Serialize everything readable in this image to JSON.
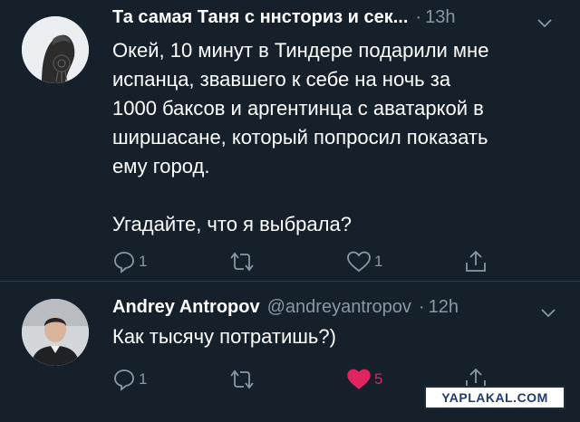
{
  "tweets": [
    {
      "author_name": "Та самая Таня с ннсториз и сек...",
      "separator": "·",
      "time": "13h",
      "text_lines": [
        "Окей, 10 минут в Тиндере подарили мне",
        "испанца, звавшего к себе на ночь за",
        "1000 баксов и аргентинца с аватаркой в",
        "ширшасане, который попросил показать",
        "ему город."
      ],
      "text_last": "Угадайте, что я выбрала?",
      "reply_count": "1",
      "like_count": "1",
      "liked": false
    },
    {
      "author_name": "Andrey Antropov",
      "handle": "@andreyantropov",
      "separator": "·",
      "time": "12h",
      "text": "Как тысячу потратишь?)",
      "reply_count": "1",
      "like_count": "5",
      "liked": true
    }
  ],
  "watermark": "YAPLAKAL.COM",
  "colors": {
    "background": "#15202b",
    "text_secondary": "#8899a6",
    "like_active": "#e0245e",
    "divider": "#2b3a48"
  },
  "icons": [
    "reply-icon",
    "retweet-icon",
    "like-icon",
    "share-icon",
    "chevron-down-icon"
  ]
}
